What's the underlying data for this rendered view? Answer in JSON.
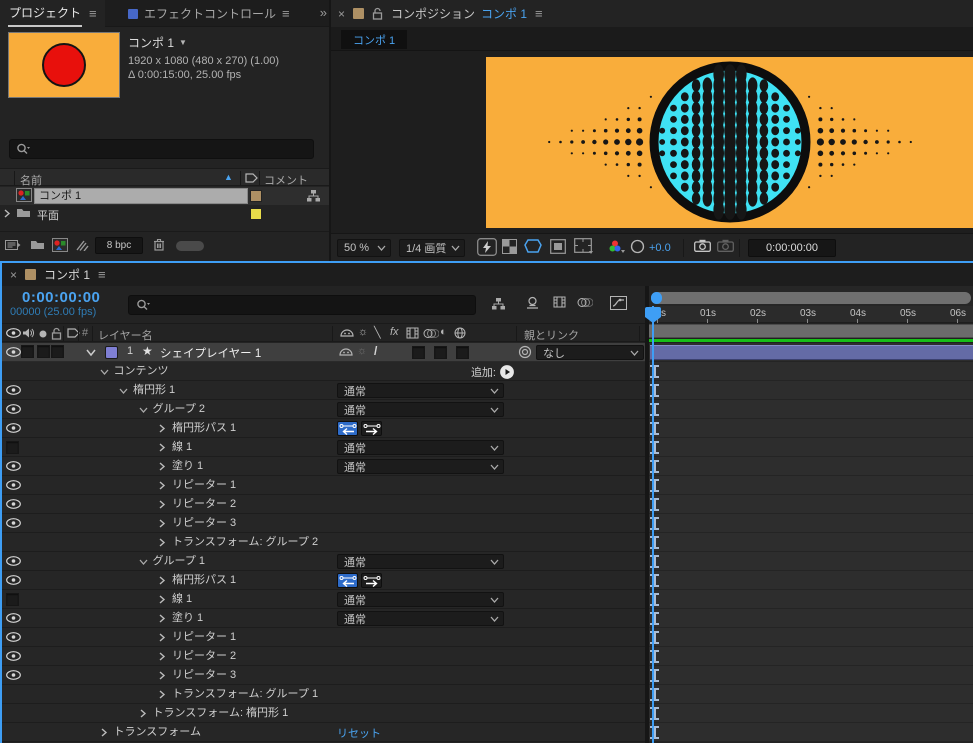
{
  "colors": {
    "accent_blue": "#4aa3f0",
    "playhead_blue": "#3e9ef5",
    "canvas_bg": "#f9ad3b",
    "circle_fill": "#3fe2f4",
    "dot_color": "#161616",
    "circle_stroke": "#0d0d0d",
    "thumb_red": "#e8100c",
    "cache_green": "#17be17",
    "layer_bar": "#646ba6",
    "label_tan": "#ae9064",
    "label_yellow": "#e8dc4a",
    "label_periwinkle": "#7f7fd4"
  },
  "icons": {
    "legend": [
      "search-icon",
      "eye-icon",
      "speaker-icon",
      "solo-icon",
      "lock-icon",
      "tag-icon",
      "star-icon",
      "menu-icon",
      "close-icon",
      "chevron-down-icon",
      "chevron-right-icon",
      "sort-up-icon",
      "flowchart-icon",
      "folder-icon",
      "composition-icon",
      "footage-interpret-icon",
      "brush-icon",
      "trash-icon",
      "pickwhip-icon",
      "shy-icon",
      "collapse-sun-icon",
      "quality-icon",
      "fx-icon",
      "frame-blend-icon",
      "motion-blur-icon",
      "adjustment-layer-icon",
      "3d-layer-icon",
      "graph-editor-icon",
      "draft-3d-icon",
      "fast-preview-icon",
      "transparency-grid-icon",
      "mask-visibility-icon",
      "region-of-interest-icon",
      "safe-frames-icon",
      "channels-icon",
      "exposure-icon",
      "snapshot-icon",
      "show-snapshot-icon",
      "add-play-icon",
      "path-reverse-left-icon",
      "path-direction-right-icon"
    ]
  },
  "project_panel": {
    "tabs": [
      {
        "label": "プロジェクト",
        "active": true
      },
      {
        "label": "エフェクトコントロール",
        "active": false
      }
    ],
    "overflow": "»",
    "item_info": {
      "name": "コンポ 1",
      "line1": "1920 x 1080  (480 x 270) (1.00)",
      "line2": "Δ 0:00:15:00, 25.00 fps"
    },
    "search_placeholder": "",
    "columns": {
      "name": "名前",
      "comment": "コメント"
    },
    "rows": [
      {
        "name": "コンポ 1",
        "type": "composition",
        "selected": true
      },
      {
        "name": "平面",
        "type": "folder",
        "selected": false
      }
    ],
    "footer": {
      "bit_depth": "8 bpc"
    }
  },
  "comp_panel": {
    "close": "×",
    "title": "コンポジション",
    "comp_name": "コンポ 1",
    "tab": "コンポ 1",
    "toolbar": {
      "zoom": "50 %",
      "quality": "1/4 画質",
      "exposure": "+0.0",
      "timecode": "0:00:00:00"
    }
  },
  "timeline_panel": {
    "close": "×",
    "tab": "コンポ 1",
    "timecode": "0:00:00:00",
    "frame_info": "00000 (25.00 fps)",
    "columns": {
      "number": "#",
      "layer_name": "レイヤー名",
      "parent": "親とリンク"
    },
    "layer": {
      "index": "1",
      "name": "シェイプレイヤー 1",
      "parent_value": "なし"
    },
    "blend_default": "通常",
    "add_label": "追加:",
    "reset_label": "リセット",
    "properties": [
      {
        "label": "コンテンツ",
        "indent": 1,
        "chevron": "down",
        "eye": null,
        "control": "add"
      },
      {
        "label": "楕円形 1",
        "indent": 2,
        "chevron": "down",
        "eye": true,
        "control": "blend"
      },
      {
        "label": "グループ 2",
        "indent": 3,
        "chevron": "down",
        "eye": true,
        "control": "blend"
      },
      {
        "label": "楕円形パス 1",
        "indent": 4,
        "chevron": "right",
        "eye": true,
        "control": "path"
      },
      {
        "label": "線 1",
        "indent": 4,
        "chevron": "right",
        "eye": false,
        "control": "blend"
      },
      {
        "label": "塗り 1",
        "indent": 4,
        "chevron": "right",
        "eye": true,
        "control": "blend"
      },
      {
        "label": "リピーター 1",
        "indent": 4,
        "chevron": "right",
        "eye": true,
        "control": "none"
      },
      {
        "label": "リピーター 2",
        "indent": 4,
        "chevron": "right",
        "eye": true,
        "control": "none"
      },
      {
        "label": "リピーター 3",
        "indent": 4,
        "chevron": "right",
        "eye": true,
        "control": "none"
      },
      {
        "label": "トランスフォーム: グループ 2",
        "indent": 4,
        "chevron": "right",
        "eye": null,
        "control": "none"
      },
      {
        "label": "グループ 1",
        "indent": 3,
        "chevron": "down",
        "eye": true,
        "control": "blend"
      },
      {
        "label": "楕円形パス 1",
        "indent": 4,
        "chevron": "right",
        "eye": true,
        "control": "path"
      },
      {
        "label": "線 1",
        "indent": 4,
        "chevron": "right",
        "eye": false,
        "control": "blend"
      },
      {
        "label": "塗り 1",
        "indent": 4,
        "chevron": "right",
        "eye": true,
        "control": "blend"
      },
      {
        "label": "リピーター 1",
        "indent": 4,
        "chevron": "right",
        "eye": true,
        "control": "none"
      },
      {
        "label": "リピーター 2",
        "indent": 4,
        "chevron": "right",
        "eye": true,
        "control": "none"
      },
      {
        "label": "リピーター 3",
        "indent": 4,
        "chevron": "right",
        "eye": true,
        "control": "none"
      },
      {
        "label": "トランスフォーム: グループ 1",
        "indent": 4,
        "chevron": "right",
        "eye": null,
        "control": "none"
      },
      {
        "label": "トランスフォーム: 楕円形 1",
        "indent": 3,
        "chevron": "right",
        "eye": null,
        "control": "none"
      },
      {
        "label": "トランスフォーム",
        "indent": 1,
        "chevron": "right",
        "eye": null,
        "control": "reset"
      }
    ],
    "ruler_labels": [
      "00s",
      "01s",
      "02s",
      "03s",
      "04s",
      "05s",
      "06s"
    ]
  }
}
